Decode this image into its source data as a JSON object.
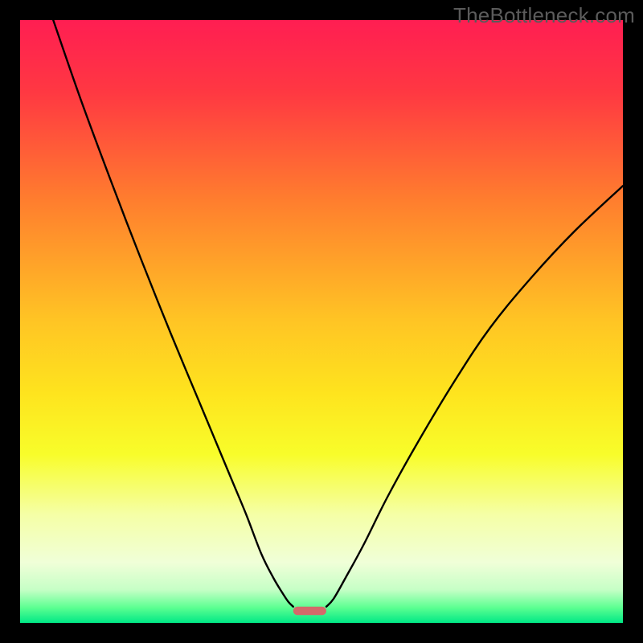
{
  "watermark": "TheBottleneck.com",
  "chart_data": {
    "type": "line",
    "title": "",
    "xlabel": "",
    "ylabel": "",
    "xlim": [
      0,
      100
    ],
    "ylim": [
      0,
      100
    ],
    "background_gradient_stops": [
      {
        "offset": 0.0,
        "color": "#ff1e52"
      },
      {
        "offset": 0.12,
        "color": "#ff3842"
      },
      {
        "offset": 0.3,
        "color": "#ff7e2e"
      },
      {
        "offset": 0.5,
        "color": "#ffc524"
      },
      {
        "offset": 0.62,
        "color": "#fee41e"
      },
      {
        "offset": 0.72,
        "color": "#f8fd2a"
      },
      {
        "offset": 0.82,
        "color": "#f5ffa6"
      },
      {
        "offset": 0.9,
        "color": "#f0ffd8"
      },
      {
        "offset": 0.945,
        "color": "#c6ffc6"
      },
      {
        "offset": 0.975,
        "color": "#5bff91"
      },
      {
        "offset": 1.0,
        "color": "#00e886"
      }
    ],
    "series": [
      {
        "name": "left-curve",
        "x": [
          5.5,
          10,
          15,
          20,
          25,
          30,
          35,
          37.5,
          40,
          42,
          43.5,
          44.5,
          45.3
        ],
        "y": [
          100,
          87,
          73.5,
          60.5,
          48,
          36,
          24,
          18,
          11.5,
          7.5,
          5,
          3.5,
          2.7
        ]
      },
      {
        "name": "right-curve",
        "x": [
          50.8,
          52,
          54,
          57,
          61,
          66,
          72,
          78,
          85,
          92,
          100
        ],
        "y": [
          2.7,
          4,
          7.5,
          13,
          21,
          30,
          40,
          49,
          57.5,
          65,
          72.5
        ]
      }
    ],
    "baseline_bar": {
      "x_start": 45.3,
      "x_end": 50.8,
      "y": 2.0,
      "height": 1.4,
      "color": "#d46a6a"
    }
  }
}
